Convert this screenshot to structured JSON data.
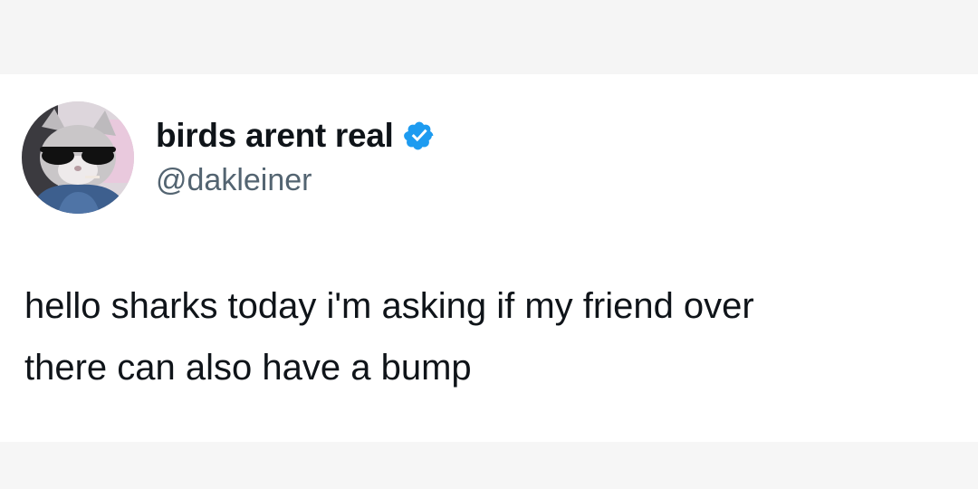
{
  "tweet": {
    "display_name": "birds arent real",
    "handle": "@dakleiner",
    "verified": true,
    "text_lines": [
      "hello sharks today i'm asking if my friend over",
      "there can also have a bump"
    ],
    "avatar": {
      "icon": "cat-with-sunglasses-avatar"
    }
  },
  "colors": {
    "verified_badge": "#1d9bf0",
    "name_text": "#0f1419",
    "handle_text": "#536471",
    "card_background": "#ffffff",
    "page_background": "#f6f6f6"
  }
}
